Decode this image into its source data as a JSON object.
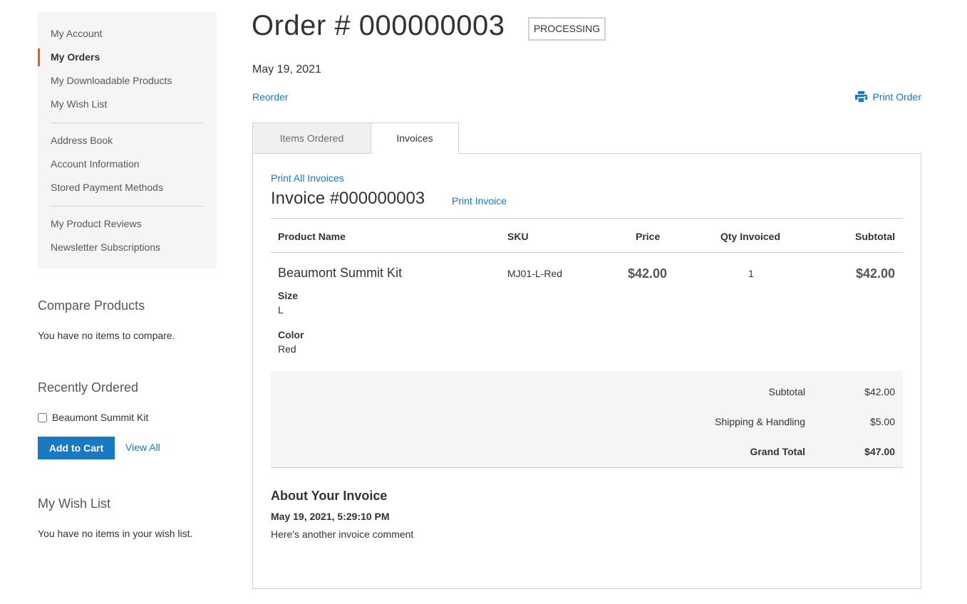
{
  "sidebar": {
    "nav": [
      {
        "label": "My Account"
      },
      {
        "label": "My Orders"
      },
      {
        "label": "My Downloadable Products"
      },
      {
        "label": "My Wish List"
      },
      {
        "label": "Address Book"
      },
      {
        "label": "Account Information"
      },
      {
        "label": "Stored Payment Methods"
      },
      {
        "label": "My Product Reviews"
      },
      {
        "label": "Newsletter Subscriptions"
      }
    ],
    "active_item": "My Orders",
    "compare": {
      "title": "Compare Products",
      "empty_text": "You have no items to compare."
    },
    "recently_ordered": {
      "title": "Recently Ordered",
      "item": "Beaumont Summit Kit",
      "add_to_cart": "Add to Cart",
      "view_all": "View All"
    },
    "wishlist": {
      "title": "My Wish List",
      "empty_text": "You have no items in your wish list."
    }
  },
  "order": {
    "title": "Order # 000000003",
    "status": "PROCESSING",
    "date": "May 19, 2021",
    "reorder": "Reorder",
    "print_order": "Print Order"
  },
  "tabs": [
    {
      "label": "Items Ordered",
      "active": false
    },
    {
      "label": "Invoices",
      "active": true
    }
  ],
  "invoice": {
    "print_all": "Print All Invoices",
    "title": "Invoice #000000003",
    "print_invoice": "Print Invoice",
    "columns": [
      "Product Name",
      "SKU",
      "Price",
      "Qty Invoiced",
      "Subtotal"
    ],
    "item": {
      "name": "Beaumont Summit Kit",
      "sku": "MJ01-L-Red",
      "price": "$42.00",
      "qty": "1",
      "subtotal": "$42.00",
      "options": [
        {
          "label": "Size",
          "value": "L"
        },
        {
          "label": "Color",
          "value": "Red"
        }
      ]
    },
    "totals": [
      {
        "label": "Subtotal",
        "value": "$42.00"
      },
      {
        "label": "Shipping & Handling",
        "value": "$5.00"
      },
      {
        "label": "Grand Total",
        "value": "$47.00"
      }
    ],
    "about": {
      "title": "About Your Invoice",
      "comment_date": "May 19, 2021, 5:29:10 PM",
      "comment": "Here's another invoice comment"
    }
  },
  "colors": {
    "link": "#1979c3",
    "active_marker": "#ff5501",
    "button": "#1979c3"
  },
  "icons": {
    "print": "printer-icon"
  }
}
